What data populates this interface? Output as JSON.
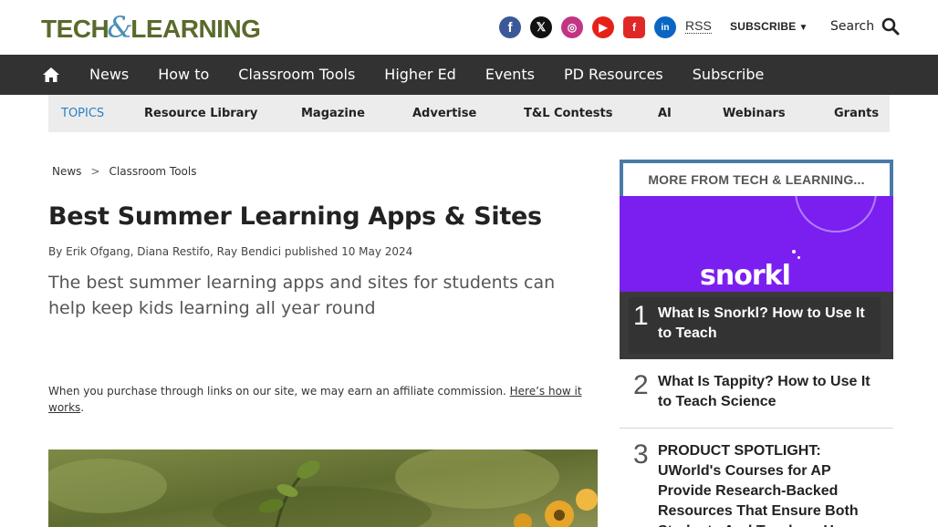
{
  "header": {
    "logo_left": "TECH",
    "logo_amp": "&",
    "logo_right": "LEARNING",
    "social_icons": [
      "facebook-icon",
      "x-icon",
      "instagram-icon",
      "youtube-icon",
      "flipboard-icon",
      "linkedin-icon"
    ],
    "social_glyphs": {
      "facebook": "f",
      "x": "𝕏",
      "instagram": "◎",
      "youtube": "▶",
      "flipboard": "f",
      "linkedin": "in"
    },
    "rss": "RSS",
    "subscribe": "SUBSCRIBE",
    "search": "Search"
  },
  "nav": {
    "items": [
      "News",
      "How to",
      "Classroom Tools",
      "Higher Ed",
      "Events",
      "PD Resources",
      "Subscribe"
    ]
  },
  "topics": {
    "label": "TOPICS",
    "items": [
      "Resource Library",
      "Magazine",
      "Advertise",
      "T&L Contests",
      "AI",
      "Webinars",
      "Grants"
    ]
  },
  "article": {
    "breadcrumb": [
      "News",
      "Classroom Tools"
    ],
    "breadcrumb_sep": ">",
    "title": "Best Summer Learning Apps & Sites",
    "byline": "By Erik Ofgang, Diana Restifo, Ray Bendici published 10 May 2024",
    "strapline": "The best summer learning apps and sites for students can help keep kids learning all year round",
    "affiliate_text": "When you purchase through links on our site, we may earn an affiliate commission. ",
    "affiliate_link": "Here’s how it works",
    "affiliate_end": "."
  },
  "sidebar": {
    "heading": "MORE FROM TECH & LEARNING...",
    "feature_brand": "snorkl",
    "items": [
      {
        "rank": "1",
        "title": "What Is Snorkl? How to Use It to Teach"
      },
      {
        "rank": "2",
        "title": "What Is Tappity? How to Use It to Teach Science"
      },
      {
        "rank": "3",
        "title": "PRODUCT SPOTLIGHT: UWorld's Courses for AP Provide Research-Backed Resources That Ensure Both Students And Teachers Have"
      }
    ]
  },
  "colors": {
    "nav_bg": "#323232",
    "topics_label": "#2a7fc4",
    "sidebar_accent": "#4a7aa8",
    "feature_bg": "#7b1ff0"
  }
}
